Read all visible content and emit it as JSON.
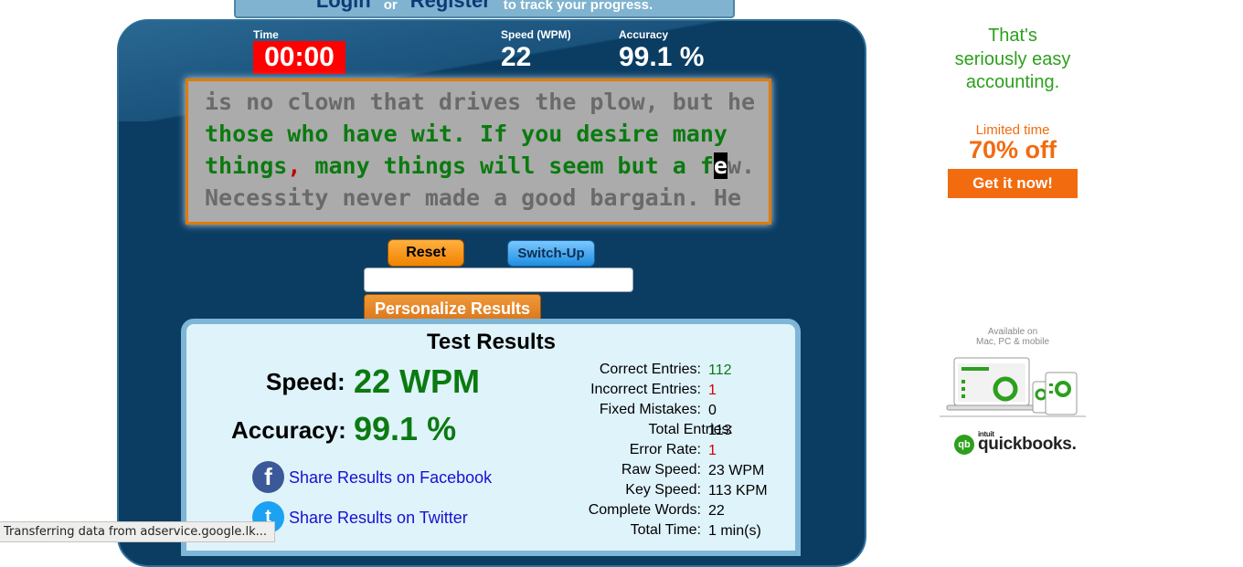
{
  "login_banner": {
    "login": "Login",
    "or": "or",
    "register": "Register",
    "suffix": "to track your progress."
  },
  "stats": {
    "time_label": "Time",
    "time_value": "00:00",
    "speed_label": "Speed (WPM)",
    "speed_value": "22",
    "accuracy_label": "Accuracy",
    "accuracy_value": "99.1 %"
  },
  "typing_text": {
    "line1": "is no clown that drives the plow, but he",
    "line2": "those who have wit. If you desire many",
    "line3_typed": "things",
    "line3_error": ",",
    "line3_typed2": " many things will seem but a f",
    "line3_cursor": "e",
    "line3_rest": "w.",
    "line4": "Necessity never made a good bargain. He"
  },
  "buttons": {
    "reset": "Reset",
    "switch_up": "Switch-Up",
    "personalize": "Personalize Results"
  },
  "results": {
    "title": "Test Results",
    "speed_label": "Speed:",
    "speed_value": "22 WPM",
    "accuracy_label": "Accuracy:",
    "accuracy_value": "99.1 %",
    "share_facebook": "Share Results on Facebook",
    "share_twitter": "Share Results on Twitter",
    "details": [
      {
        "label": "Correct Entries:",
        "value": "112",
        "color": "green"
      },
      {
        "label": "Incorrect Entries:",
        "value": "1",
        "color": "red"
      },
      {
        "label": "Fixed Mistakes:",
        "value": "0",
        "color": "black"
      },
      {
        "label": "Total Entries:",
        "value": "113",
        "color": "black"
      },
      {
        "label": "Error Rate:",
        "value": "1",
        "color": "red"
      },
      {
        "label": "Raw Speed:",
        "value": "23 WPM",
        "color": "black"
      },
      {
        "label": "Key Speed:",
        "value": "113 KPM",
        "color": "black"
      },
      {
        "label": "Complete Words:",
        "value": "22",
        "color": "black"
      },
      {
        "label": "Total Time:",
        "value": "1 min(s)",
        "color": "black"
      }
    ]
  },
  "ad": {
    "line1": "That's",
    "line2": "seriously easy",
    "line3": "accounting.",
    "limited": "Limited time",
    "offer": "70% off",
    "cta": "Get it now!",
    "available_line1": "Available on",
    "available_line2": "Mac, PC & mobile",
    "logo_intuit": "intuit",
    "logo_text": "quickbooks.",
    "logo_mark": "qb",
    "brand_color": "#2ca01c",
    "accent_color": "#f26b0f"
  },
  "status_bar": {
    "text": "Transferring data from adservice.google.lk..."
  }
}
